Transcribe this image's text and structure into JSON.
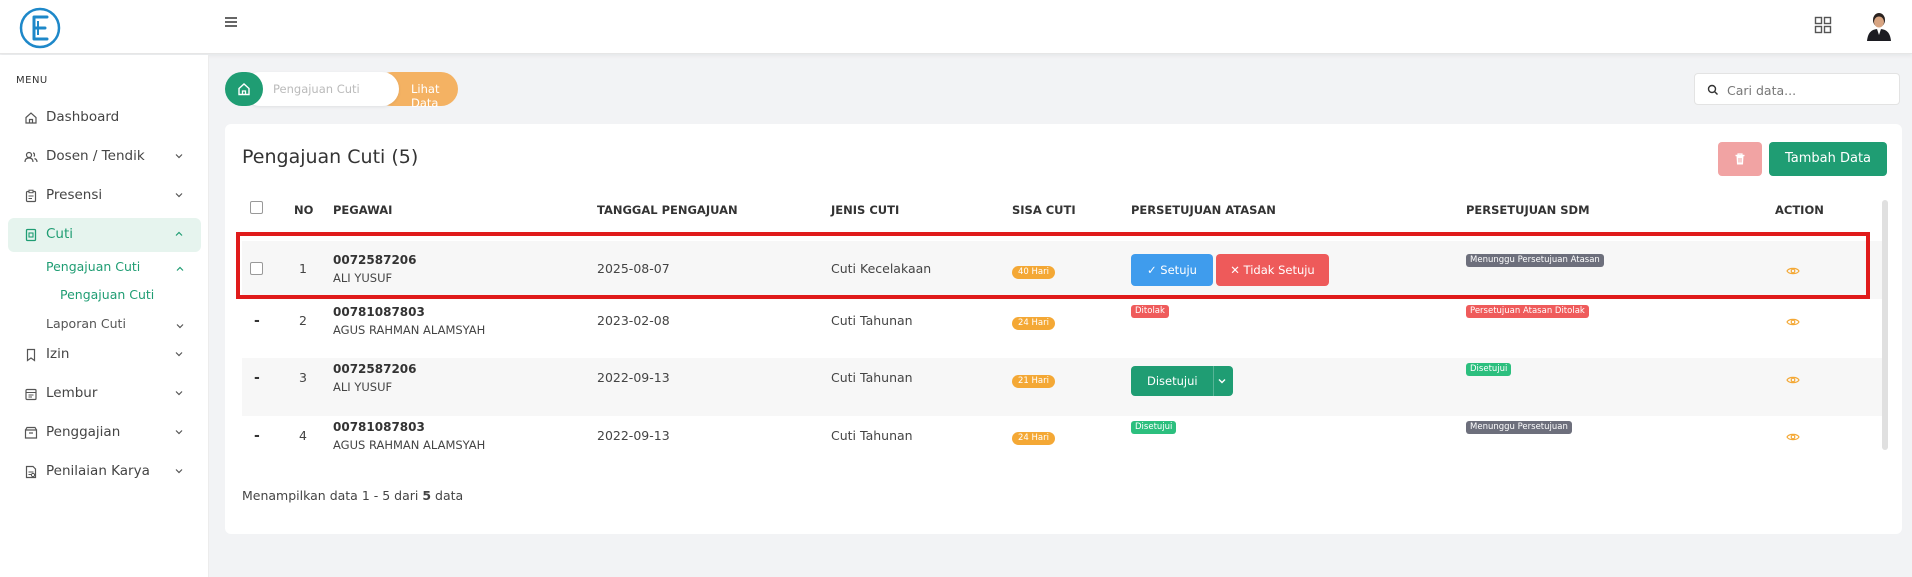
{
  "sidebar": {
    "menu_label": "MENU",
    "items": [
      {
        "label": "Dashboard",
        "icon": "home-icon"
      },
      {
        "label": "Dosen / Tendik",
        "icon": "users-icon"
      },
      {
        "label": "Presensi",
        "icon": "clipboard-icon"
      },
      {
        "label": "Cuti",
        "icon": "cuti-icon"
      },
      {
        "label": "Izin",
        "icon": "bookmark-icon"
      },
      {
        "label": "Lembur",
        "icon": "calendar-icon"
      },
      {
        "label": "Penggajian",
        "icon": "wallet-icon"
      },
      {
        "label": "Penilaian Karya",
        "icon": "document-icon"
      }
    ],
    "sub": {
      "pengajuan_cuti": "Pengajuan Cuti",
      "pengajuan_cuti_child": "Pengajuan Cuti",
      "laporan_cuti": "Laporan Cuti"
    }
  },
  "breadcrumb": {
    "middle": "Pengajuan Cuti",
    "last": "Lihat Data"
  },
  "search": {
    "placeholder": "Cari data..."
  },
  "card": {
    "title": "Pengajuan Cuti (5)",
    "add_button": "Tambah Data"
  },
  "table": {
    "headers": {
      "no": "NO",
      "pegawai": "PEGAWAI",
      "tanggal": "TANGGAL PENGAJUAN",
      "jenis": "JENIS CUTI",
      "sisa": "SISA CUTI",
      "atasan": "PERSETUJUAN ATASAN",
      "sdm": "PERSETUJUAN SDM",
      "action": "ACTION"
    },
    "rows": [
      {
        "no": "1",
        "code": "0072587206",
        "name": "ALI YUSUF",
        "date": "2025-08-07",
        "jenis": "Cuti Kecelakaan",
        "sisa": "40 Hari",
        "setuju_label": "✓ Setuju",
        "tolak_label": "✕ Tidak Setuju",
        "sdm": "Menunggu Persetujuan Atasan"
      },
      {
        "marker": "-",
        "no": "2",
        "code": "00781087803",
        "name": "AGUS RAHMAN ALAMSYAH",
        "date": "2023-02-08",
        "jenis": "Cuti Tahunan",
        "sisa": "24 Hari",
        "atasan": "Ditolak",
        "sdm": "Persetujuan Atasan Ditolak"
      },
      {
        "marker": "-",
        "no": "3",
        "code": "0072587206",
        "name": "ALI YUSUF",
        "date": "2022-09-13",
        "jenis": "Cuti Tahunan",
        "sisa": "21 Hari",
        "atasan_dropdown": "Disetujui",
        "sdm": "Disetujui"
      },
      {
        "marker": "-",
        "no": "4",
        "code": "00781087803",
        "name": "AGUS RAHMAN ALAMSYAH",
        "date": "2022-09-13",
        "jenis": "Cuti Tahunan",
        "sisa": "24 Hari",
        "atasan": "Disetujui",
        "sdm": "Menunggu Persetujuan"
      }
    ]
  },
  "footer": {
    "prefix": "Menampilkan data ",
    "range": "1 - 5",
    "middle": " dari ",
    "total": "5",
    "suffix": " data"
  },
  "colors": {
    "primary": "#1f9d73",
    "accent_orange": "#f4b263",
    "danger": "#ee5a5a",
    "info": "#3f9ced",
    "highlight_border": "#e01b1b"
  }
}
